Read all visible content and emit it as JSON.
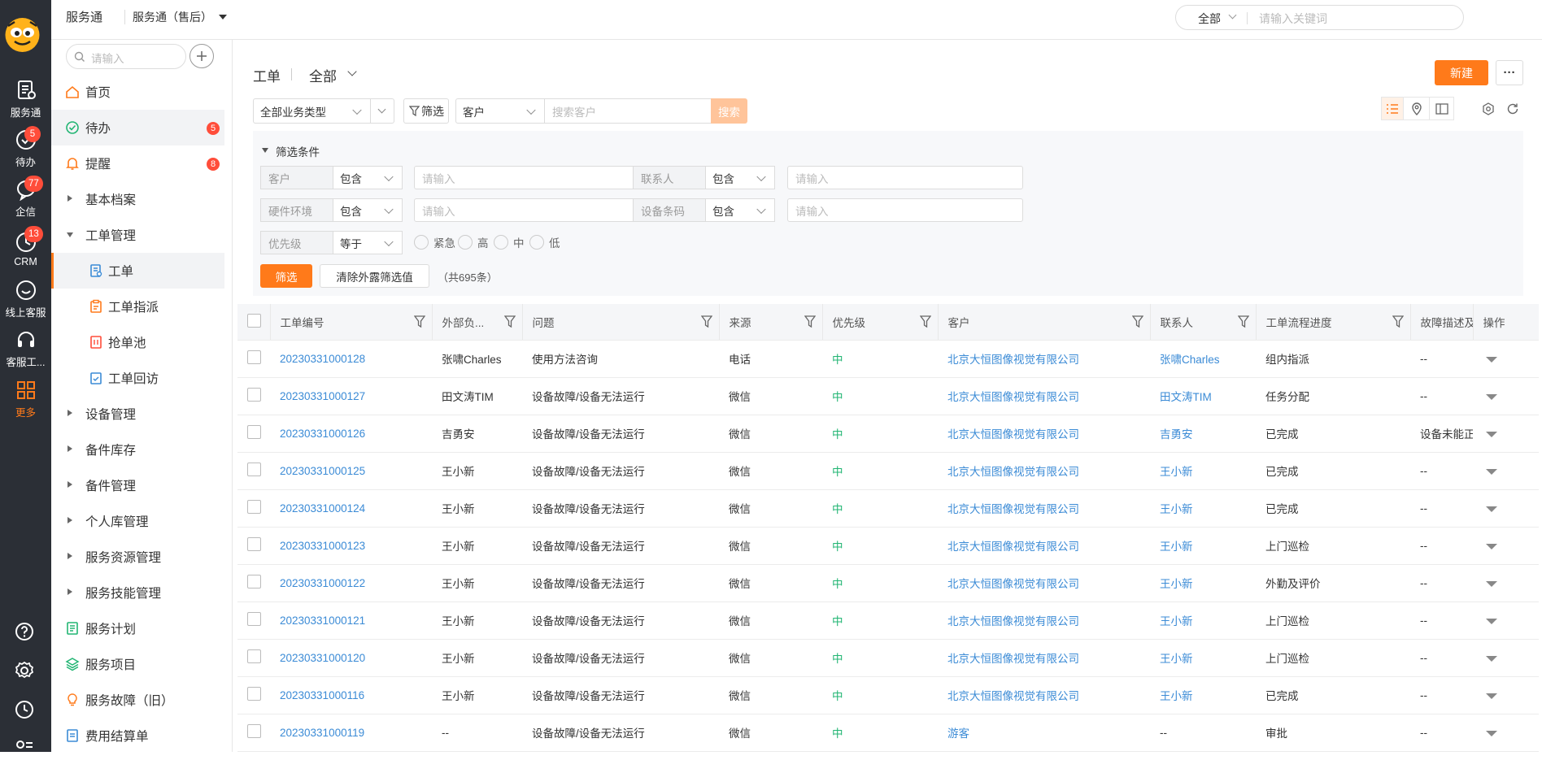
{
  "rail": {
    "items": [
      {
        "label": "服务通",
        "icon": "service-icon"
      },
      {
        "label": "待办",
        "icon": "check-circle-icon",
        "badge": "5"
      },
      {
        "label": "企信",
        "icon": "chat-icon",
        "badge": "77"
      },
      {
        "label": "CRM",
        "icon": "clock-icon",
        "badge": "13"
      },
      {
        "label": "线上客服",
        "icon": "smile-icon"
      },
      {
        "label": "客服工...",
        "icon": "headset-icon"
      },
      {
        "label": "更多",
        "icon": "grid-icon"
      }
    ]
  },
  "top": {
    "app": "服务通",
    "account": "服务通（售后）",
    "search_scope": "全部",
    "search_placeholder": "请输入关键词"
  },
  "sidebar": {
    "search_placeholder": "请输入",
    "items": [
      {
        "label": "首页",
        "icon": "home-icon"
      },
      {
        "label": "待办",
        "icon": "check-circle-icon",
        "badge": "5"
      },
      {
        "label": "提醒",
        "icon": "bell-icon",
        "badge": "8"
      },
      {
        "label": "基本档案",
        "icon": "caret-right-icon"
      },
      {
        "label": "工单管理",
        "icon": "caret-down-icon"
      },
      {
        "label": "工单",
        "icon": "ticket-icon"
      },
      {
        "label": "工单指派",
        "icon": "clipboard-icon"
      },
      {
        "label": "抢单池",
        "icon": "grab-icon"
      },
      {
        "label": "工单回访",
        "icon": "return-visit-icon"
      },
      {
        "label": "设备管理",
        "icon": "caret-right-icon"
      },
      {
        "label": "备件库存",
        "icon": "caret-right-icon"
      },
      {
        "label": "备件管理",
        "icon": "caret-right-icon"
      },
      {
        "label": "个人库管理",
        "icon": "caret-right-icon"
      },
      {
        "label": "服务资源管理",
        "icon": "caret-right-icon"
      },
      {
        "label": "服务技能管理",
        "icon": "caret-right-icon"
      },
      {
        "label": "服务计划",
        "icon": "plan-icon"
      },
      {
        "label": "服务项目",
        "icon": "layers-icon"
      },
      {
        "label": "服务故障（旧）",
        "icon": "bulb-icon"
      },
      {
        "label": "费用结算单",
        "icon": "bill-icon"
      }
    ]
  },
  "header": {
    "title": "工单",
    "view": "全部",
    "new_label": "新建",
    "more_label": "···"
  },
  "toolbar": {
    "biz_type": "全部业务类型",
    "filter_label": "筛选",
    "field": "客户",
    "search_placeholder": "搜索客户",
    "search_label": "搜索"
  },
  "filter": {
    "title": "筛选条件",
    "rows": [
      {
        "label": "客户",
        "op": "包含",
        "placeholder": "请输入",
        "label2": "联系人",
        "op2": "包含",
        "placeholder2": "请输入"
      },
      {
        "label": "硬件环境",
        "op": "包含",
        "placeholder": "请输入",
        "label2": "设备条码",
        "op2": "包含",
        "placeholder2": "请输入"
      }
    ],
    "priority_label": "优先级",
    "priority_op": "等于",
    "options": [
      "紧急",
      "高",
      "中",
      "低"
    ],
    "apply_label": "筛选",
    "clear_label": "清除外露筛选值",
    "count": "（共695条）"
  },
  "table": {
    "columns": [
      "工单编号",
      "外部负...",
      "问题",
      "来源",
      "优先级",
      "客户",
      "联系人",
      "工单流程进度",
      "故障描述及",
      "操作"
    ],
    "rows": [
      [
        "20230331000128",
        "张啸Charles",
        "使用方法咨询",
        "电话",
        "中",
        "北京大恒图像视觉有限公司",
        "张啸Charles",
        "组内指派",
        "--"
      ],
      [
        "20230331000127",
        "田文涛TIM",
        "设备故障/设备无法运行",
        "微信",
        "中",
        "北京大恒图像视觉有限公司",
        "田文涛TIM",
        "任务分配",
        "--"
      ],
      [
        "20230331000126",
        "吉勇安",
        "设备故障/设备无法运行",
        "微信",
        "中",
        "北京大恒图像视觉有限公司",
        "吉勇安",
        "已完成",
        "设备未能正常"
      ],
      [
        "20230331000125",
        "王小新",
        "设备故障/设备无法运行",
        "微信",
        "中",
        "北京大恒图像视觉有限公司",
        "王小新",
        "已完成",
        "--"
      ],
      [
        "20230331000124",
        "王小新",
        "设备故障/设备无法运行",
        "微信",
        "中",
        "北京大恒图像视觉有限公司",
        "王小新",
        "已完成",
        "--"
      ],
      [
        "20230331000123",
        "王小新",
        "设备故障/设备无法运行",
        "微信",
        "中",
        "北京大恒图像视觉有限公司",
        "王小新",
        "上门巡检",
        "--"
      ],
      [
        "20230331000122",
        "王小新",
        "设备故障/设备无法运行",
        "微信",
        "中",
        "北京大恒图像视觉有限公司",
        "王小新",
        "外勤及评价",
        "--"
      ],
      [
        "20230331000121",
        "王小新",
        "设备故障/设备无法运行",
        "微信",
        "中",
        "北京大恒图像视觉有限公司",
        "王小新",
        "上门巡检",
        "--"
      ],
      [
        "20230331000120",
        "王小新",
        "设备故障/设备无法运行",
        "微信",
        "中",
        "北京大恒图像视觉有限公司",
        "王小新",
        "上门巡检",
        "--"
      ],
      [
        "20230331000116",
        "王小新",
        "设备故障/设备无法运行",
        "微信",
        "中",
        "北京大恒图像视觉有限公司",
        "王小新",
        "已完成",
        "--"
      ],
      [
        "20230331000119",
        "--",
        "设备故障/设备无法运行",
        "微信",
        "中",
        "游客",
        "--",
        "审批",
        "--"
      ]
    ]
  },
  "colors": {
    "accent": "#ff7a1a",
    "link": "#3b8bd6",
    "priority_mid": "#22b573",
    "badge": "#ff4d3a",
    "rail_bg": "#2b2f36"
  }
}
